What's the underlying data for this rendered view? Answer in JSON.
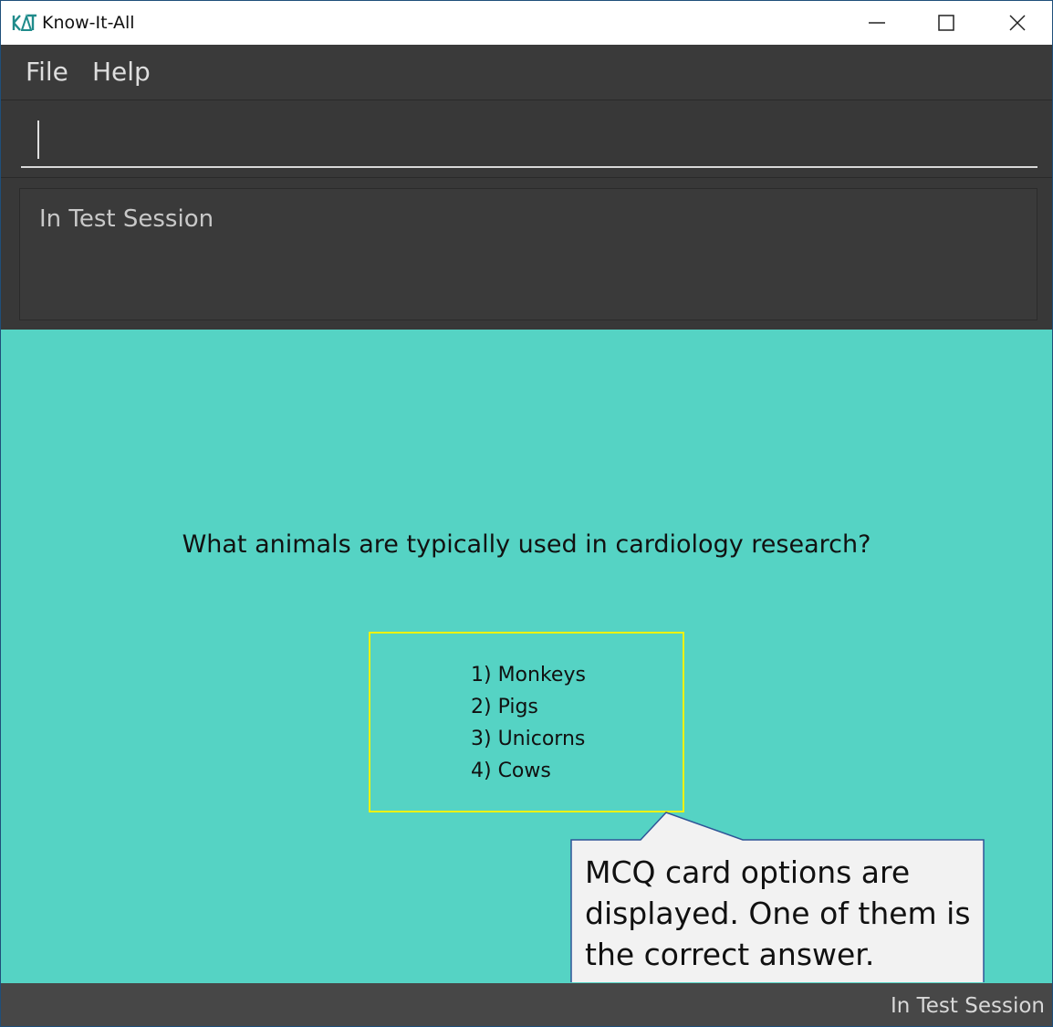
{
  "window": {
    "title": "Know-It-All",
    "logo_icon": "know-it-all-logo-icon",
    "controls": {
      "minimize_icon": "minimize-icon",
      "maximize_icon": "maximize-icon",
      "close_icon": "close-icon"
    }
  },
  "menu": {
    "items": [
      {
        "label": "File"
      },
      {
        "label": "Help"
      }
    ]
  },
  "command_box": {
    "value": "",
    "placeholder": ""
  },
  "result_display": {
    "text": "In Test Session"
  },
  "card": {
    "question": "What animals are typically used in cardiology research?",
    "options": [
      "1) Monkeys",
      "2) Pigs",
      "3) Unicorns",
      "4) Cows"
    ]
  },
  "callout": {
    "lines": [
      "MCQ card options are",
      "displayed. One of them is",
      "the correct answer."
    ]
  },
  "status_bar": {
    "text": "In Test Session"
  },
  "colors": {
    "card_background": "#55d3c4",
    "options_border": "#f2f200",
    "dark_panel": "#3a3a3a",
    "status_bar": "#474747",
    "callout_fill": "#f2f2f2",
    "callout_border": "#2f5597",
    "logo": "#1f8b8b"
  }
}
